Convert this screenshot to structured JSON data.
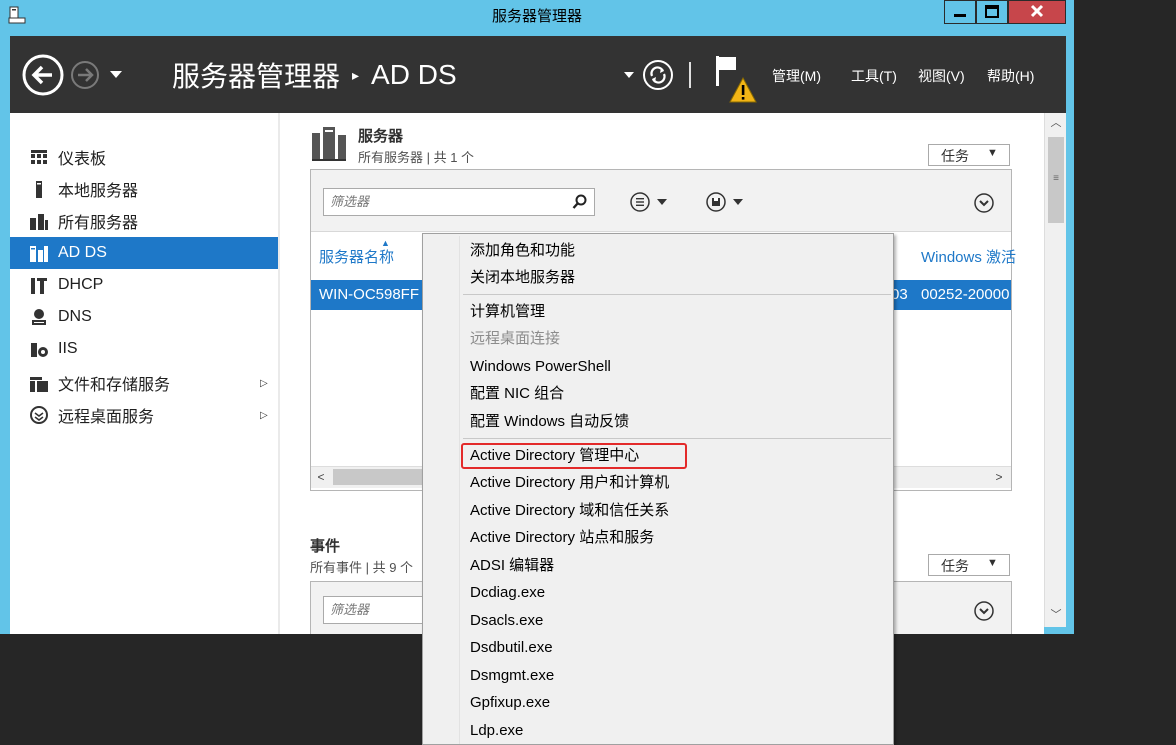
{
  "window": {
    "title": "服务器管理器"
  },
  "header": {
    "breadcrumb": {
      "root": "服务器管理器",
      "separator": "▸",
      "current": "AD DS"
    },
    "menu": {
      "manage": "管理(M)",
      "tools": "工具(T)",
      "view": "视图(V)",
      "help": "帮助(H)"
    }
  },
  "sidebar": {
    "items": [
      {
        "label": "仪表板",
        "icon": "dashboard-icon"
      },
      {
        "label": "本地服务器",
        "icon": "local-server-icon"
      },
      {
        "label": "所有服务器",
        "icon": "all-servers-icon"
      },
      {
        "label": "AD DS",
        "icon": "ad-ds-icon",
        "active": true
      },
      {
        "label": "DHCP",
        "icon": "dhcp-icon"
      },
      {
        "label": "DNS",
        "icon": "dns-icon"
      },
      {
        "label": "IIS",
        "icon": "iis-icon"
      },
      {
        "label": "文件和存储服务",
        "icon": "file-storage-icon",
        "has_submenu": true
      },
      {
        "label": "远程桌面服务",
        "icon": "remote-desktop-icon",
        "has_submenu": true
      }
    ]
  },
  "servers": {
    "title": "服务器",
    "subtitle": "所有服务器 | 共 1 个",
    "tasks_label": "任务",
    "filter_placeholder": "筛选器",
    "columns": {
      "name": "服务器名称",
      "windows": "Windows 激活"
    },
    "row": {
      "name": "WIN-OC598FF",
      "partial": "03",
      "activation": "00252-20000"
    }
  },
  "events": {
    "title": "事件",
    "subtitle": "所有事件 | 共 9 个",
    "tasks_label": "任务",
    "filter_placeholder": "筛选器"
  },
  "context_menu": {
    "items": [
      {
        "label": "添加角色和功能",
        "disabled": false
      },
      {
        "label": "关闭本地服务器",
        "disabled": false
      },
      {
        "label": "计算机管理",
        "disabled": false
      },
      {
        "label": "远程桌面连接",
        "disabled": true
      },
      {
        "label": "Windows PowerShell",
        "disabled": false
      },
      {
        "label": "配置 NIC 组合",
        "disabled": false
      },
      {
        "label": "配置 Windows 自动反馈",
        "disabled": false
      },
      {
        "label": "Active Directory 管理中心",
        "disabled": false,
        "highlighted": true
      },
      {
        "label": "Active Directory 用户和计算机",
        "disabled": false
      },
      {
        "label": "Active Directory 域和信任关系",
        "disabled": false
      },
      {
        "label": "Active Directory 站点和服务",
        "disabled": false
      },
      {
        "label": "ADSI 编辑器",
        "disabled": false
      },
      {
        "label": "Dcdiag.exe",
        "disabled": false
      },
      {
        "label": "Dsacls.exe",
        "disabled": false
      },
      {
        "label": "Dsdbutil.exe",
        "disabled": false
      },
      {
        "label": "Dsmgmt.exe",
        "disabled": false
      },
      {
        "label": "Gpfixup.exe",
        "disabled": false
      },
      {
        "label": "Ldp.exe",
        "disabled": false
      }
    ]
  },
  "colors": {
    "accent": "#1e78c8",
    "titlebar": "#62c4e8",
    "header": "#333333",
    "highlight_border": "#e32a2a",
    "close": "#c7464b"
  }
}
